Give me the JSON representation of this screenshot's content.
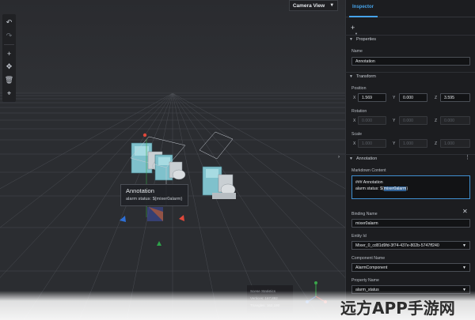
{
  "viewport": {
    "camera_view_label": "Camera View",
    "annotation_popup": {
      "title": "Annotation",
      "body": "alarm status: ${mixer0alarm}"
    },
    "stats": {
      "title": "Scene Statistics",
      "vertices": "Vertices: 167,892",
      "triangles": "Triangles: 162,180"
    }
  },
  "toolbar": {
    "icons": [
      "undo-icon",
      "redo-icon",
      "add-icon",
      "transform-icon",
      "delete-icon",
      "target-icon"
    ]
  },
  "inspector": {
    "tab_label": "Inspector",
    "add_label": "+",
    "properties": {
      "header": "Properties",
      "name_label": "Name",
      "name_value": "Annotation"
    },
    "transform": {
      "header": "Transform",
      "position_label": "Position",
      "position": {
        "x": "1.569",
        "y": "0.000",
        "z": "3.595"
      },
      "rotation_label": "Rotation",
      "rotation": {
        "x": "0.000",
        "y": "0.000",
        "z": "0.000"
      },
      "scale_label": "Scale",
      "scale": {
        "x": "1.000",
        "y": "1.000",
        "z": "1.000"
      },
      "axes": {
        "x": "X",
        "y": "Y",
        "z": "Z"
      }
    },
    "annotation": {
      "header": "Annotation",
      "markdown_label": "Markdown Content",
      "markdown_line1": "### Annotation",
      "markdown_line2_prefix": "alarm status: ${",
      "markdown_line2_highlight": "mixer0alarm",
      "markdown_line2_suffix": "}",
      "binding_name_label": "Binding Name",
      "binding_name_value": "mixer0alarm",
      "entity_id_label": "Entity Id",
      "entity_id_value": "Mixer_0_cd81d9fd-3f74-437e-802b-5747ff240",
      "component_name_label": "Component Name",
      "component_name_value": "AlarmComponent",
      "property_name_label": "Property Name",
      "property_name_value": "alarm_status"
    }
  },
  "watermark": "远方APP手游网",
  "colors": {
    "accent": "#46a3ea",
    "panel": "#1c1d20",
    "viewport": "#2b2d31"
  }
}
